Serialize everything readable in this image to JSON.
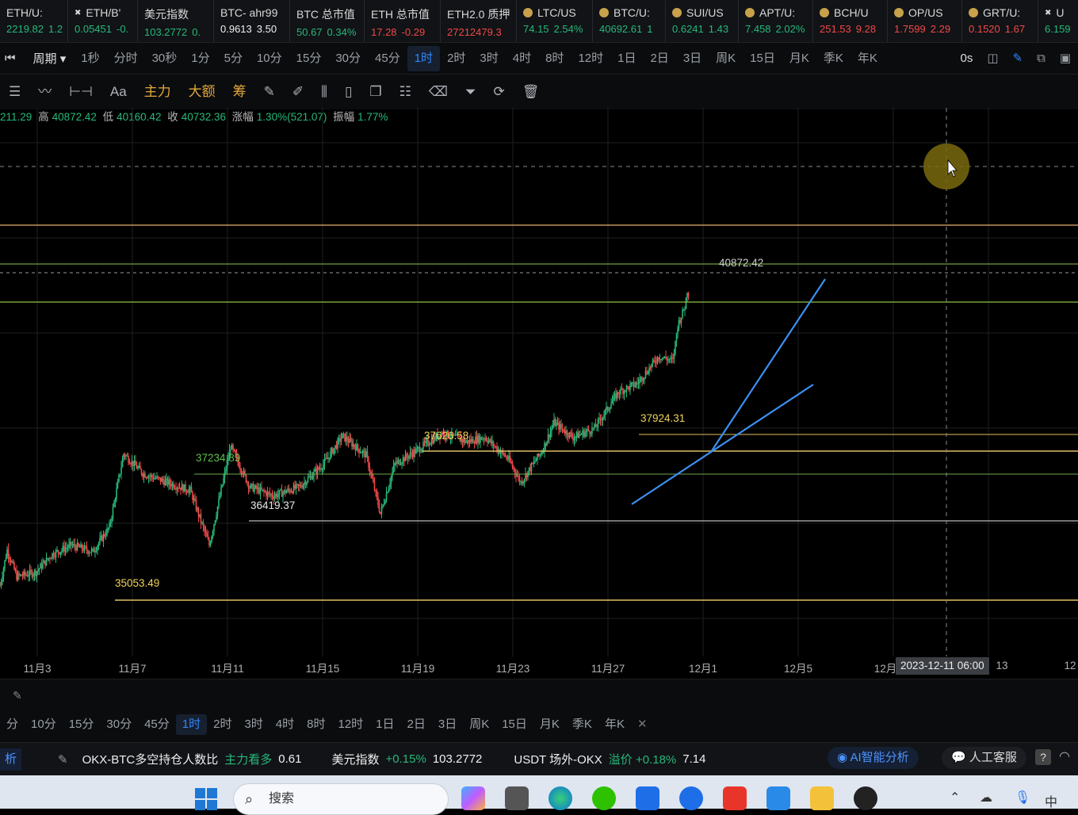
{
  "tickers": [
    {
      "name": "ETH/U:",
      "price": "2219.82",
      "change": "1.2",
      "dir": "up",
      "icon": "none"
    },
    {
      "name": "ETH/B'",
      "price": "0.05451",
      "change": "-0.",
      "dir": "up",
      "icon": "okx-icon"
    },
    {
      "name": "美元指数",
      "price": "103.2772",
      "change": "0.",
      "dir": "up",
      "icon": "none"
    },
    {
      "name": "BTC- ahr99",
      "price": "0.9613",
      "change": "3.50",
      "dir": "white",
      "icon": "none"
    },
    {
      "name": "BTC 总市值",
      "price": "50.67",
      "change": "0.34%",
      "dir": "up",
      "icon": "none"
    },
    {
      "name": "ETH 总市值",
      "price": "17.28",
      "change": "-0.29",
      "dir": "down",
      "icon": "none"
    },
    {
      "name": "ETH2.0 质押",
      "price": "27212479.3",
      "change": "",
      "dir": "down",
      "icon": "none"
    },
    {
      "name": "LTC/US",
      "price": "74.15",
      "change": "2.54%",
      "dir": "up",
      "icon": "coin-icon"
    },
    {
      "name": "BTC/U:",
      "price": "40692.61",
      "change": "1",
      "dir": "up",
      "icon": "coin-icon"
    },
    {
      "name": "SUI/US",
      "price": "0.6241",
      "change": "1.43",
      "dir": "up",
      "icon": "coin-icon"
    },
    {
      "name": "APT/U:",
      "price": "7.458",
      "change": "2.02%",
      "dir": "up",
      "icon": "coin-icon"
    },
    {
      "name": "BCH/U",
      "price": "251.53",
      "change": "9.28",
      "dir": "down",
      "icon": "coin-icon"
    },
    {
      "name": "OP/US",
      "price": "1.7599",
      "change": "2.29",
      "dir": "down",
      "icon": "coin-icon"
    },
    {
      "name": "GRT/U:",
      "price": "0.1520",
      "change": "1.67",
      "dir": "down",
      "icon": "coin-icon"
    },
    {
      "name": "U",
      "price": "6.159",
      "change": "",
      "dir": "up",
      "icon": "okx-icon"
    }
  ],
  "period_bar": {
    "label": "周期",
    "items": [
      "1秒",
      "分时",
      "30秒",
      "1分",
      "5分",
      "10分",
      "15分",
      "30分",
      "45分",
      "1时",
      "2时",
      "3时",
      "4时",
      "8时",
      "12时",
      "1日",
      "2日",
      "3日",
      "周K",
      "15日",
      "月K",
      "季K",
      "年K"
    ],
    "active": "1时",
    "countdown": "0s"
  },
  "toolbar": {
    "items": [
      "主力",
      "大额",
      "筹"
    ],
    "font_label": "Aa"
  },
  "ohlc": {
    "open": "211.29",
    "high_label": "高",
    "high": "40872.42",
    "low_label": "低",
    "low": "40160.42",
    "close_label": "收",
    "close": "40732.36",
    "change_label": "涨幅",
    "change": "1.30%(521.07)",
    "amp_label": "振幅",
    "amp": "1.77%"
  },
  "chart_data": {
    "type": "candlestick",
    "symbol_interval": "1时",
    "x_labels": [
      "11月3",
      "11月7",
      "11月11",
      "11月15",
      "11月19",
      "11月23",
      "11月27",
      "12月1",
      "12月5",
      "12月",
      "13",
      "12"
    ],
    "annotations": [
      {
        "text": "40872.42",
        "color": "#cfcfcf"
      },
      {
        "text": "37924.31",
        "color": "#f0d35a"
      },
      {
        "text": "37626.58",
        "color": "#f0d35a"
      },
      {
        "text": "37234.89",
        "color": "#5fbf4a"
      },
      {
        "text": "36419.37",
        "color": "#e8e8e8"
      },
      {
        "text": "35053.49",
        "color": "#f0d35a"
      }
    ],
    "crosshair_date": "2023-12-11 06:00",
    "lines": {
      "up": "#27b87a",
      "down": "#f04848",
      "trend": "#3d8ff0",
      "level_gold": "#e0c060",
      "level_green": "#6aa84f"
    }
  },
  "sub_panel": {
    "periods": [
      "分",
      "10分",
      "15分",
      "30分",
      "45分",
      "1时",
      "2时",
      "3时",
      "4时",
      "8时",
      "12时",
      "1日",
      "2日",
      "3日",
      "周K",
      "15日",
      "月K",
      "季K",
      "年K"
    ],
    "active": "1时",
    "close_glyph": "✕"
  },
  "status_bar": {
    "left_label": "析",
    "ratio_label": "OKX-BTC多空持仓人数比",
    "ratio_sentiment": "主力看多",
    "ratio_value": "0.61",
    "usd_label": "美元指数",
    "usd_change": "+0.15%",
    "usd_value": "103.2772",
    "usdt_label": "USDT 场外-OKX",
    "premium_label": "溢价 +0.18%",
    "premium_value": "7.14",
    "ai_label": "AI智能分析",
    "support_label": "人工客服",
    "help_label": "?"
  },
  "taskbar": {
    "search_placeholder": "搜索",
    "ime_label": "中"
  }
}
